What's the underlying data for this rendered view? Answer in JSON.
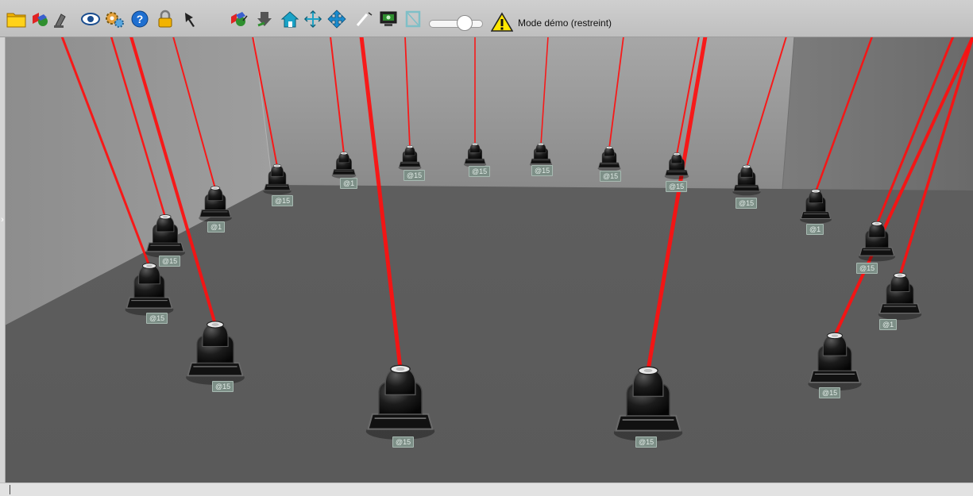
{
  "toolbar": {
    "buttons": [
      {
        "name": "open-folder-icon"
      },
      {
        "name": "3d-objects-icon"
      },
      {
        "name": "spot-fixture-icon"
      },
      {
        "name": "eye-view-icon"
      },
      {
        "name": "settings-gears-icon"
      },
      {
        "name": "help-icon"
      },
      {
        "name": "lock-icon"
      },
      {
        "name": "pin-icon"
      },
      {
        "name": "add-object-icon"
      },
      {
        "name": "move-down-icon"
      },
      {
        "name": "home-view-icon"
      },
      {
        "name": "focus-arrows-icon"
      },
      {
        "name": "move-arrows-icon"
      },
      {
        "name": "laser-icon"
      },
      {
        "name": "screenshot-icon"
      },
      {
        "name": "frame-icon"
      }
    ],
    "slider_level": 0.7,
    "mode_label": "Mode démo (restreint)"
  },
  "colors": {
    "beam": "#ff0f0f",
    "floor": "#5b5b5b",
    "tag_bg": "#7d8f87",
    "toolbar_bg": "#c8c8c8",
    "warning": "#ffe600"
  },
  "fixtures": [
    {
      "name": "fixture-back-1",
      "label": "@15"
    },
    {
      "name": "fixture-back-2",
      "label": "@1"
    },
    {
      "name": "fixture-back-3",
      "label": "@15"
    },
    {
      "name": "fixture-back-4",
      "label": "@15"
    },
    {
      "name": "fixture-back-5",
      "label": "@15"
    },
    {
      "name": "fixture-back-6",
      "label": "@15"
    },
    {
      "name": "fixture-back-7",
      "label": "@15"
    },
    {
      "name": "fixture-back-8",
      "label": "@15"
    },
    {
      "name": "fixture-right-1",
      "label": "@1"
    },
    {
      "name": "fixture-right-2",
      "label": "@15"
    },
    {
      "name": "fixture-right-3",
      "label": "@1"
    },
    {
      "name": "fixture-right-4",
      "label": "@15"
    },
    {
      "name": "fixture-front-right",
      "label": "@15"
    },
    {
      "name": "fixture-front-left",
      "label": "@15"
    },
    {
      "name": "fixture-left-1",
      "label": "@15"
    },
    {
      "name": "fixture-left-2",
      "label": "@15"
    },
    {
      "name": "fixture-left-3",
      "label": "@15"
    },
    {
      "name": "fixture-left-4",
      "label": "@1"
    },
    {
      "name": "fixture-left-5",
      "label": "@15"
    }
  ],
  "status": {
    "text": ""
  }
}
